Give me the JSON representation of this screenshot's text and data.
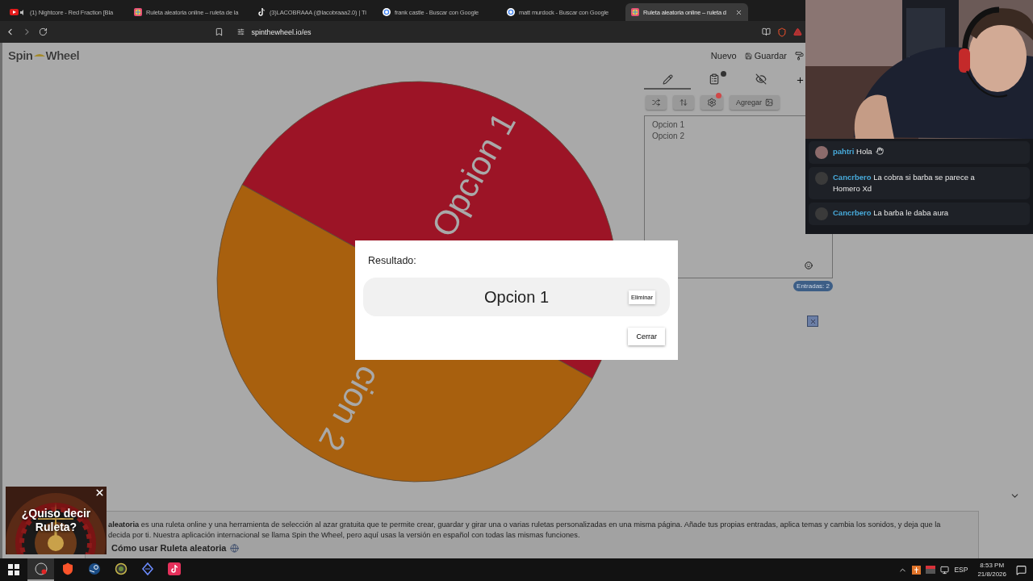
{
  "browser": {
    "tabs": [
      {
        "kind": "youtube",
        "title": "(1) Nightcore - Red Fraction [Bla",
        "selected": false
      },
      {
        "kind": "wheel",
        "title": "Ruleta aleatoria online – ruleta de la",
        "selected": false
      },
      {
        "kind": "tiktok",
        "title": "(3)LACOBRAAA (@lacobraaa2.0) | Ti",
        "selected": false
      },
      {
        "kind": "google",
        "title": "frank castle - Buscar con Google",
        "selected": false
      },
      {
        "kind": "google",
        "title": "matt murdock - Buscar con Google",
        "selected": false
      },
      {
        "kind": "wheel",
        "title": "Ruleta aleatoria online – ruleta d",
        "selected": true
      }
    ],
    "address": "spinthewheel.io/es"
  },
  "app": {
    "logo": [
      "Spin",
      "Wheel"
    ],
    "header_buttons": [
      {
        "kind": "new",
        "label": "Nuevo"
      },
      {
        "kind": "save",
        "label": "Guardar"
      }
    ],
    "panel_tabs": [
      {
        "kind": "edit",
        "selected": true
      },
      {
        "kind": "list",
        "selected": false
      },
      {
        "kind": "hidden",
        "selected": false
      }
    ],
    "tools": [
      {
        "kind": "shuffle"
      },
      {
        "kind": "sort"
      },
      {
        "kind": "settings",
        "alert": true
      },
      {
        "kind": "add",
        "label": "Agregar"
      }
    ],
    "entries": [
      "Opcion 1",
      "Opcion 2"
    ],
    "entry_count": "Entradas: 2",
    "wheel": {
      "segments": [
        {
          "label": "Opcion 1",
          "color": "#9c1426"
        },
        {
          "label": "cion 2",
          "color": "#a8600e"
        }
      ]
    },
    "description": {
      "lines": [
        "**aleatoria** es una ruleta online y una herramienta de selección al azar gratuita que te permite crear, guardar y girar una o varias ruletas personalizadas en una misma página. Añade tus propias entradas, aplica temas y cambia los sonidos, y deja que la",
        "decida por ti. Nuestra aplicación internacional se llama Spin the Wheel, pero aquí usas la versión en español con todas las mismas funciones."
      ],
      "heading": "Cómo usar Ruleta aleatoria"
    }
  },
  "result_dialog": {
    "title": "Resultado:",
    "result": "Opcion 1",
    "remove": "Eliminar",
    "close": "Cerrar"
  },
  "ad": {
    "text": "¿Quiso decir Ruleta?"
  },
  "chat": [
    {
      "user": "pahtri",
      "message": "Hola",
      "wave": true
    },
    {
      "user": "Cancrbero",
      "message": "La cobra si barba se parece a Homero Xd",
      "wave": false
    },
    {
      "user": "Cancrbero",
      "message": "La barba le daba aura",
      "wave": false
    }
  ],
  "taskbar": {
    "apps": [
      {
        "kind": "obs",
        "selected": true
      },
      {
        "kind": "brave",
        "selected": false
      },
      {
        "kind": "steam",
        "selected": false
      },
      {
        "kind": "globe",
        "selected": false
      },
      {
        "kind": "diamond",
        "selected": false
      },
      {
        "kind": "tiktok",
        "selected": false
      }
    ],
    "language": "ESP",
    "time": "8:53 PM",
    "date": "21/8/2026"
  }
}
